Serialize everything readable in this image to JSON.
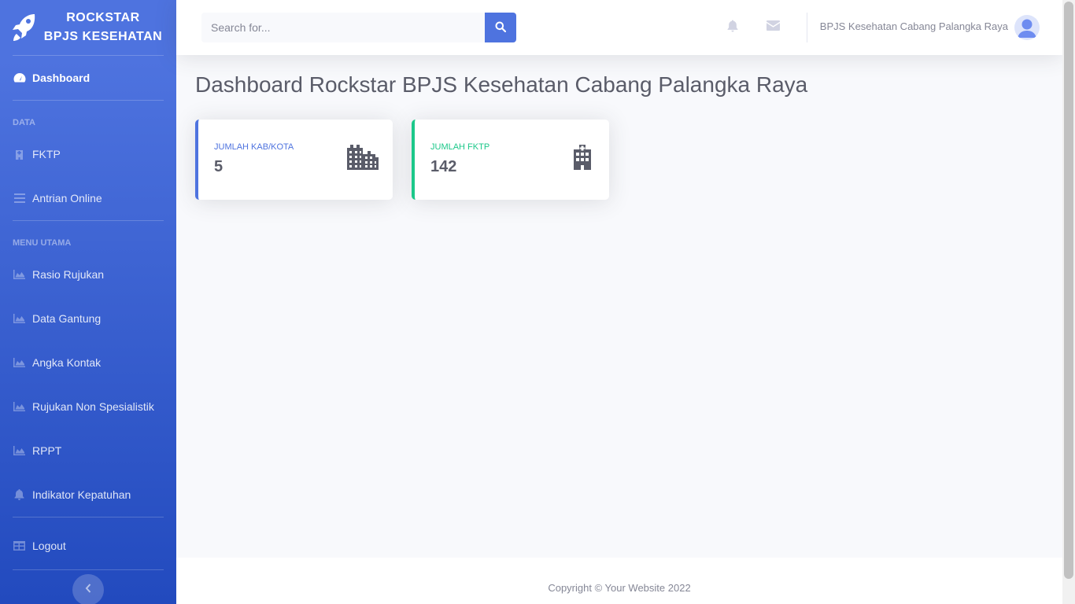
{
  "sidebar": {
    "brand_line1": "ROCKSTAR",
    "brand_line2": "BPJS KESEHATAN",
    "dashboard": "Dashboard",
    "heading_data": "DATA",
    "fktp": "FKTP",
    "antrian": "Antrian Online",
    "heading_menu": "MENU UTAMA",
    "rasio": "Rasio Rujukan",
    "gantung": "Data Gantung",
    "kontak": "Angka Kontak",
    "nonspesialistik": "Rujukan Non Spesialistik",
    "rppt": "RPPT",
    "indikator": "Indikator Kepatuhan",
    "logout": "Logout"
  },
  "topbar": {
    "search_placeholder": "Search for...",
    "user_name": "BPJS Kesehatan Cabang Palangka Raya"
  },
  "main": {
    "title": "Dashboard Rockstar BPJS Kesehatan Cabang Palangka Raya",
    "cards": [
      {
        "label": "JUMLAH KAB/KOTA",
        "value": "5",
        "color": "#4e73df",
        "icon": "city-icon"
      },
      {
        "label": "JUMLAH FKTP",
        "value": "142",
        "color": "#1cc88a",
        "icon": "hospital-icon"
      }
    ]
  },
  "footer": {
    "text": "Copyright © Your Website 2022"
  },
  "colors": {
    "primary": "#4e73df",
    "success": "#1cc88a",
    "dark": "#5a5c69"
  }
}
